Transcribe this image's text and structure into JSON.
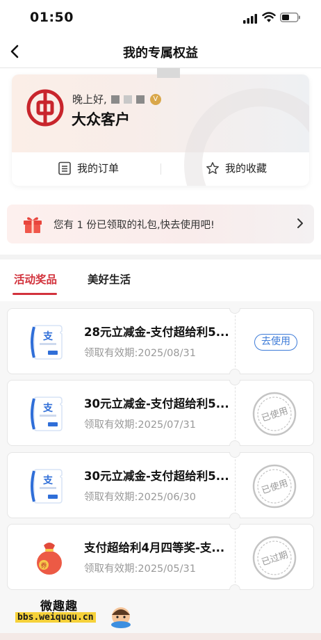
{
  "status_bar": {
    "time": "01:50"
  },
  "nav": {
    "title": "我的专属权益"
  },
  "profile": {
    "greeting": "晚上好,",
    "level": "大众客户",
    "vip_badge": "V",
    "actions": [
      {
        "label": "我的订单",
        "icon": "order-list-icon"
      },
      {
        "label": "我的收藏",
        "icon": "star-icon"
      }
    ]
  },
  "gift_banner": {
    "text": "您有 1 份已领取的礼包,快去使用吧!"
  },
  "tabs": [
    {
      "label": "活动奖品",
      "active": true
    },
    {
      "label": "美好生活",
      "active": false
    }
  ],
  "coupons": [
    {
      "title": "28元立减金-支付超给利5...",
      "validity": "领取有效期:2025/08/31",
      "status": "去使用",
      "status_type": "button",
      "icon": "alipay-coupon-icon"
    },
    {
      "title": "30元立减金-支付超给利5...",
      "validity": "领取有效期:2025/07/31",
      "status": "已使用",
      "status_type": "stamp",
      "icon": "alipay-coupon-icon"
    },
    {
      "title": "30元立减金-支付超给利5...",
      "validity": "领取有效期:2025/06/30",
      "status": "已使用",
      "status_type": "stamp",
      "icon": "alipay-coupon-icon"
    },
    {
      "title": "支付超给利4月四等奖-支...",
      "validity": "领取有效期:2025/05/31",
      "status": "已过期",
      "status_type": "stamp",
      "icon": "money-bag-icon"
    }
  ],
  "watermark": {
    "cn": "微趣趣",
    "url": "bbs.weiququ.cn"
  },
  "colors": {
    "accent": "#d2323c",
    "link_blue": "#3d7bd8",
    "muted": "#999999"
  }
}
